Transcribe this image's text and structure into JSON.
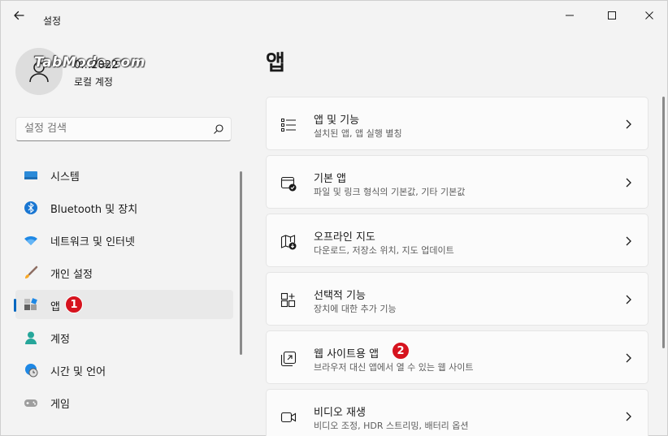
{
  "window": {
    "title": "설정"
  },
  "profile": {
    "watermark": "TabMode.com",
    "name": "0…2022",
    "account_type": "로컬 계정"
  },
  "search": {
    "placeholder": "설정 검색"
  },
  "nav": {
    "items": [
      {
        "label": "시스템",
        "icon": "system-icon"
      },
      {
        "label": "Bluetooth 및 장치",
        "icon": "bluetooth-icon"
      },
      {
        "label": "네트워크 및 인터넷",
        "icon": "wifi-icon"
      },
      {
        "label": "개인 설정",
        "icon": "brush-icon"
      },
      {
        "label": "앱",
        "icon": "apps-icon",
        "selected": true,
        "badge": "1"
      },
      {
        "label": "계정",
        "icon": "person-icon"
      },
      {
        "label": "시간 및 언어",
        "icon": "globe-clock-icon"
      },
      {
        "label": "게임",
        "icon": "gamepad-icon"
      }
    ]
  },
  "main": {
    "title": "앱",
    "cards": [
      {
        "title": "앱 및 기능",
        "desc": "설치된 앱, 앱 실행 별칭",
        "icon": "list-icon"
      },
      {
        "title": "기본 앱",
        "desc": "파일 및 링크 형식의 기본값, 기타 기본값",
        "icon": "default-app-icon"
      },
      {
        "title": "오프라인 지도",
        "desc": "다운로드, 저장소 위치, 지도 업데이트",
        "icon": "map-download-icon"
      },
      {
        "title": "선택적 기능",
        "desc": "장치에 대한 추가 기능",
        "icon": "grid-add-icon"
      },
      {
        "title": "웹 사이트용 앱",
        "desc": "브라우저 대신 앱에서 열 수 있는 웹 사이트",
        "icon": "open-external-icon",
        "badge": "2"
      },
      {
        "title": "비디오 재생",
        "desc": "비디오 조정, HDR 스트리밍, 배터리 옵션",
        "icon": "video-icon"
      }
    ]
  },
  "colors": {
    "accent": "#0067c0",
    "badge": "#d6131e"
  }
}
